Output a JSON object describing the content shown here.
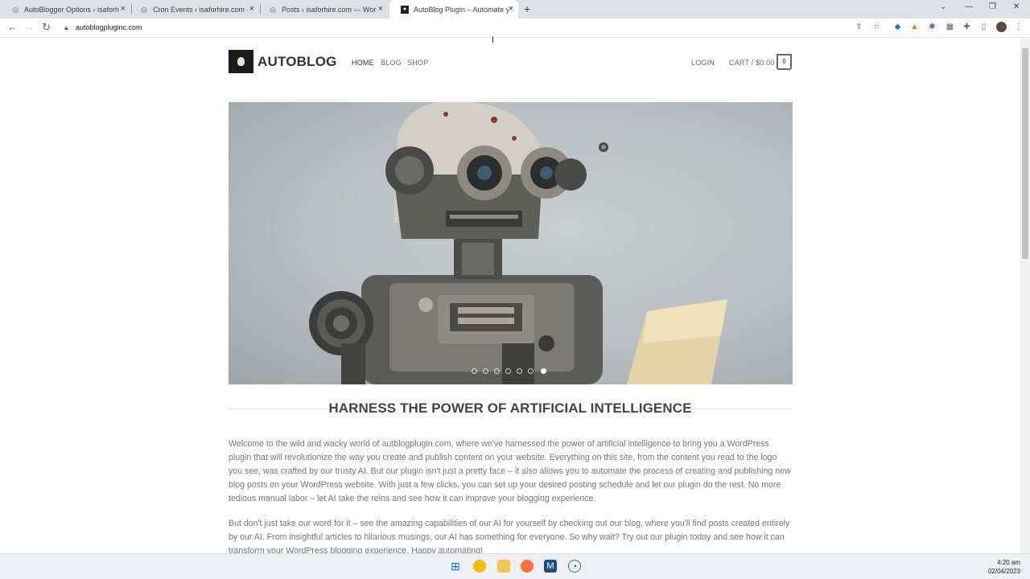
{
  "browser": {
    "tabs": [
      {
        "title": "AutoBlogger Options ‹ isaforhire",
        "favicon": "wordpress-favicon"
      },
      {
        "title": "Cron Events ‹ isaforhire.com — W",
        "favicon": "wordpress-favicon"
      },
      {
        "title": "Posts ‹ isaforhire.com — WordPre",
        "favicon": "wordpress-favicon"
      },
      {
        "title": "AutoBlog Plugin – Automate you",
        "favicon": "autoblog-favicon"
      }
    ],
    "new_tab": "+",
    "close_glyph": "×",
    "url": "autoblogpluginc.com"
  },
  "site": {
    "title": "AUTOBLOG",
    "nav": [
      "HOME",
      "BLOG",
      "SHOP"
    ],
    "login": "LOGIN",
    "cart": "CART / $0.00",
    "cart_count": "0"
  },
  "hero": {
    "slide_count": 7,
    "active_slide": 7
  },
  "content": {
    "heading": "HARNESS THE POWER OF ARTIFICIAL INTELLIGENCE",
    "paragraphs": [
      "Welcome to the wild and wacky world of autblogplugin.com, where we've harnessed the power of artificial intelligence to bring you a WordPress plugin that will revolutionize the way you create and publish content on your website. Everything on this site, from the content you read to the logo you see, was crafted by our trusty AI. But our plugin isn't just a pretty face – it also allows you to automate the process of creating and publishing new blog posts on your WordPress website. With just a few clicks, you can set up your desired posting schedule and let our plugin do the rest. No more tedious manual labor – let AI take the reins and see how it can improve your blogging experience.",
      "But don't just take our word for it – see the amazing capabilities of our AI for yourself by checking out our blog, where you'll find posts created entirely by our AI. From insightful articles to hilarious musings, our AI has something for everyone. So why wait? Try out our plugin today and see how it can transform your WordPress blogging experience. Happy automating!"
    ]
  },
  "taskbar": {
    "time": "4:20 am",
    "date": "02/04/2023"
  },
  "colors": {
    "tabbar": "#dee1e6",
    "text_muted": "#777777",
    "heading": "#444444"
  }
}
